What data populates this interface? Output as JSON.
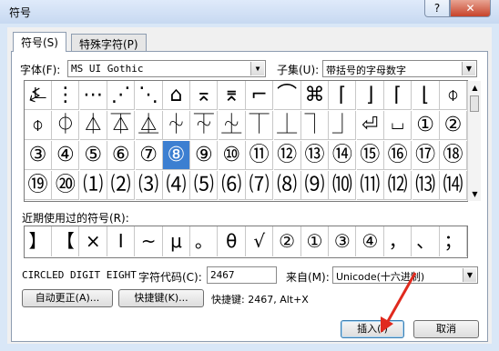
{
  "window": {
    "title": "符号",
    "help": "?",
    "close": "✕"
  },
  "tabs": [
    {
      "label": "符号(S)"
    },
    {
      "label": "特殊字符(P)"
    }
  ],
  "font": {
    "label": "字体(F):",
    "value": "MS UI Gothic"
  },
  "subset": {
    "label": "子集(U):",
    "value": "带括号的字母数字"
  },
  "grid": {
    "rows": [
      [
        "⍼",
        "⋮",
        "⋯",
        "⋰",
        "⋱",
        "⌂",
        "⌅",
        "⌆",
        "⌐",
        "⌒",
        "⌘",
        "⌈",
        "⌋",
        "⌈",
        "⌊",
        "⌽"
      ],
      [
        "⌽",
        "⏀",
        "⏃",
        "⏄",
        "⏅",
        "⏆",
        "⏇",
        "⏈",
        "⏉",
        "⏊",
        "⏋",
        "⏌",
        "⏎",
        "⏘",
        "①",
        "②"
      ],
      [
        "③",
        "④",
        "⑤",
        "⑥",
        "⑦",
        "⑧",
        "⑨",
        "⑩",
        "⑪",
        "⑫",
        "⑬",
        "⑭",
        "⑮",
        "⑯",
        "⑰",
        "⑱"
      ],
      [
        "⑲",
        "⑳",
        "⑴",
        "⑵",
        "⑶",
        "⑷",
        "⑸",
        "⑹",
        "⑺",
        "⑻",
        "⑼",
        "⑽",
        "⑾",
        "⑿",
        "⒀",
        "⒁"
      ]
    ],
    "selected": "⑧"
  },
  "recent": {
    "label": "近期使用过的符号(R):",
    "symbols": [
      "】",
      "【",
      "×",
      "Ⅰ",
      "~",
      "μ",
      "。",
      "θ",
      "√",
      "②",
      "①",
      "③",
      "④",
      "，",
      "、",
      "；"
    ]
  },
  "char_name": "CIRCLED DIGIT EIGHT",
  "char_code": {
    "label": "字符代码(C):",
    "value": "2467"
  },
  "from": {
    "label": "来自(M):",
    "value": "Unicode(十六进制)"
  },
  "buttons": {
    "autocorrect": "自动更正(A)...",
    "shortcut": "快捷键(K)...",
    "shortcut_text": "快捷键: 2467, Alt+X",
    "insert": "插入(I)",
    "cancel": "取消"
  },
  "colors": {
    "selection": "#3c7fd1",
    "annotation_arrow": "#e02a1e"
  }
}
